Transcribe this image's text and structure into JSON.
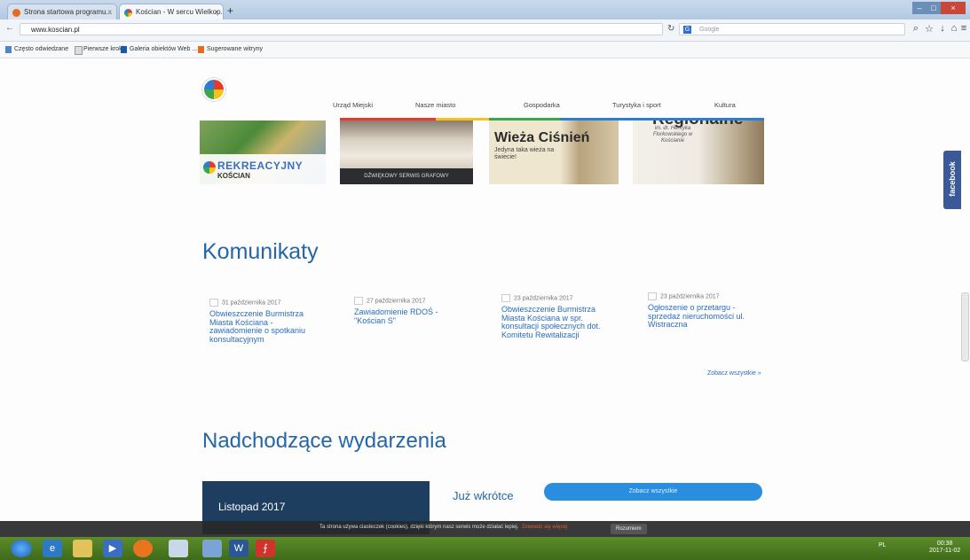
{
  "browser": {
    "tabs": [
      {
        "title": "Strona startowa programu...",
        "close": "×"
      },
      {
        "title": "Kościan - W sercu Wielkop...",
        "close": "×"
      }
    ],
    "new_tab": "+",
    "window_buttons": [
      "–",
      "□",
      "×"
    ],
    "url": "www.koscian.pl",
    "search_engine": "G",
    "search_placeholder": "Google",
    "bookmarks": [
      "Często odwiedzane",
      "Pierwsze kroki",
      "Galeria obiektów Web ...",
      "Sugerowane witryny"
    ]
  },
  "site": {
    "menu": [
      "Urząd Miejski",
      "Nasze miasto",
      "Gospodarka",
      "Turystyka i sport",
      "Kultura"
    ],
    "menu_colors": [
      "#e63a2e",
      "#f7c21a",
      "#3aa84a",
      "#2a7fd4"
    ],
    "banners": {
      "b1_title": "REKREACYJNY",
      "b1_sub": "KOŚCIAN",
      "b2_caption": "DŹWIĘKOWY SERWIS GRAFOWY",
      "b3_title": "Wieża Ciśnień",
      "b3_sub": "Jedyna taka wieża na świecie!",
      "b4_title": "Regionalne",
      "b4_sub": "im. dr. Henryka Florkowskiego w Kościanie"
    },
    "facebook_label": "facebook",
    "komunikaty": {
      "title": "Komunikaty",
      "items": [
        {
          "date": "31 października 2017",
          "title": "Obwieszczenie Burmistrza Miasta Kościana - zawiadomienie o spotkaniu konsultacyjnym"
        },
        {
          "date": "27 października 2017",
          "title": "Zawiadomienie RDOŚ - \"Kościan S\""
        },
        {
          "date": "23 października 2017",
          "title": "Obwieszczenie Burmistrza Miasta Kościana w spr. konsultacji społecznych dot. Komitetu Rewitalizacji"
        },
        {
          "date": "23 października 2017",
          "title": "Ogłoszenie o przetargu - sprzedaż nieruchomości ul. Wistraczna"
        }
      ],
      "see_all": "Zobacz wszystkie »"
    },
    "events": {
      "title": "Nadchodzące wydarzenia",
      "month": "Listopad 2017",
      "soon": "Już wkrótce",
      "see_all": "Zobacz wszystkie"
    },
    "cookie": {
      "text": "Ta strona używa ciasteczek (cookies), dzięki którym nasz serwis może działać lepiej.",
      "link": "Dowiedz się więcej",
      "button": "Rozumiem"
    }
  },
  "taskbar": {
    "tray": "PL",
    "time": "00:38",
    "date": "2017-11-02"
  }
}
